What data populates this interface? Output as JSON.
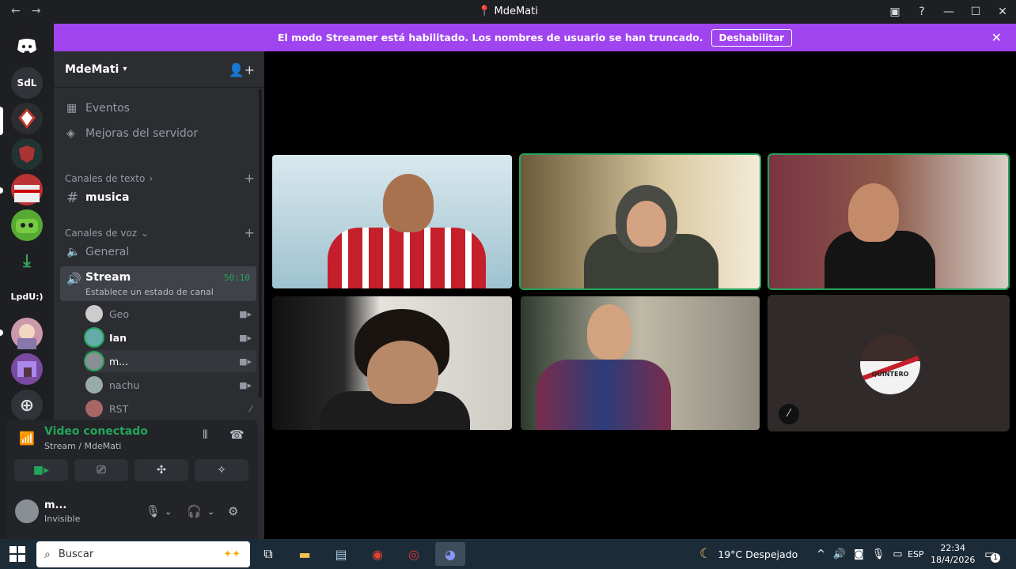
{
  "window": {
    "title": "MdeMati",
    "back": "←",
    "forward": "→"
  },
  "banner": {
    "text": "El modo Streamer está habilitado. Los nombres de usuario se han truncado.",
    "button": "Deshabilitar",
    "close": "✕"
  },
  "guilds": [
    "SdL",
    "LpdU:)"
  ],
  "server": {
    "name": "MdeMati"
  },
  "sidebar": {
    "events": "Eventos",
    "boosts": "Mejoras del servidor",
    "text_category": "Canales de texto",
    "text_channel": "musica",
    "voice_category": "Canales de voz",
    "voice_general": "General",
    "stream_channel": "Stream",
    "stream_status": "Establece un estado de canal",
    "stream_time": "50:10",
    "users": [
      "Geo",
      "Ian",
      "m...",
      "nachu",
      "RST"
    ]
  },
  "voice": {
    "status": "Video conectado",
    "location": "Stream / MdeMati"
  },
  "me": {
    "name": "m...",
    "status": "Invisible"
  },
  "taskbar": {
    "search_placeholder": "Buscar",
    "weather": "19°C  Despejado",
    "lang": "ESP",
    "time": "22:34",
    "date": "18/4/2026",
    "notif_count": "1"
  },
  "tile_label": "QUINTERO",
  "colors": {
    "accent": "#a044f0",
    "green": "#23a55a",
    "sidebar": "#2b2d31"
  }
}
